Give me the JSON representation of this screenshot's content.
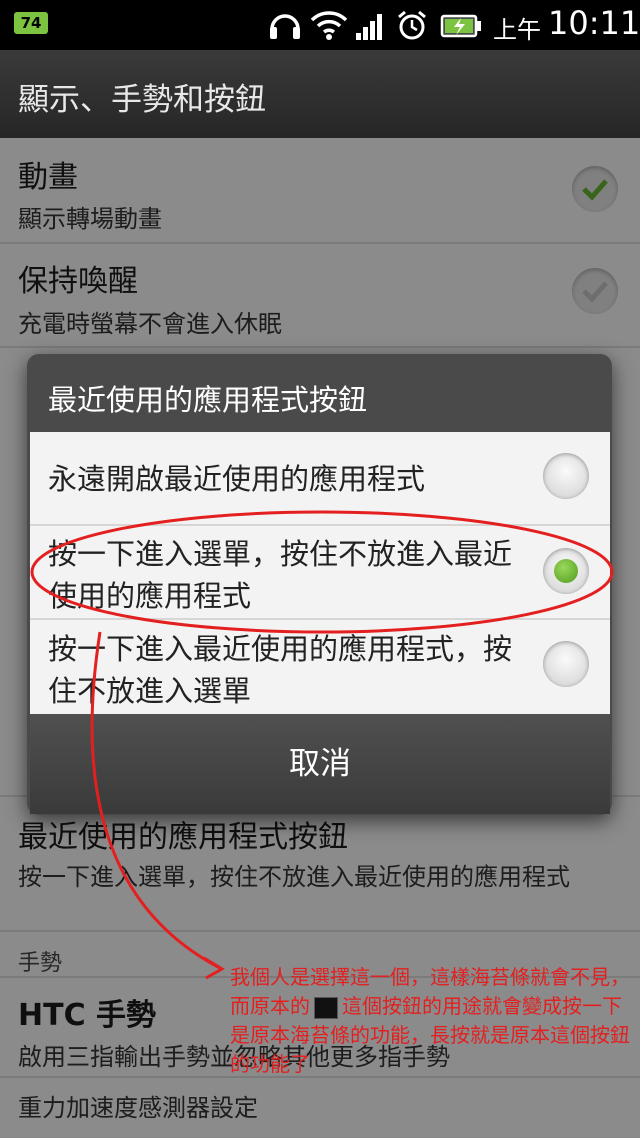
{
  "status_bar": {
    "badge": "74",
    "ampm": "上午",
    "time": "10:11",
    "icons": [
      "headset-icon",
      "wifi-icon",
      "signal-icon",
      "alarm-icon",
      "battery-icon"
    ]
  },
  "header": {
    "title": "顯示、手勢和按鈕"
  },
  "settings": {
    "animation": {
      "title": "動畫",
      "subtitle": "顯示轉場動畫"
    },
    "stay_awake": {
      "title": "保持喚醒",
      "subtitle": "充電時螢幕不會進入休眠"
    },
    "recent_apps_button": {
      "title": "最近使用的應用程式按鈕",
      "subtitle": "按一下進入選單，按住不放進入最近使用的應用程式"
    },
    "gestures_section": "手勢",
    "htc_gestures": {
      "title": "HTC 手勢",
      "subtitle": "啟用三指輸出手勢並忽略其他更多指手勢"
    },
    "gsensor": {
      "title": "重力加速度感測器設定"
    }
  },
  "dialog": {
    "title": "最近使用的應用程式按鈕",
    "options": [
      {
        "label": "永遠開啟最近使用的應用程式",
        "selected": false
      },
      {
        "label": "按一下進入選單，按住不放進入最近使用的應用程式",
        "selected": true
      },
      {
        "label": "按一下進入最近使用的應用程式，按住不放進入選單",
        "selected": false
      }
    ],
    "cancel": "取消"
  },
  "annotation": {
    "part1": "我個人是選擇這一個，這樣海苔條就會不見，而原本的",
    "part2": "這個按鈕的用途就會變成按一下是原本海苔條的功能，長按就是原本這個按鈕的功能了",
    "color": "#e41f1f"
  },
  "colors": {
    "accent_green": "#5fae2b"
  }
}
